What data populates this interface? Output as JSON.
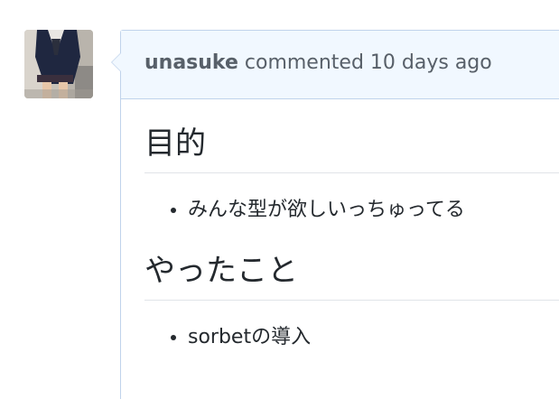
{
  "comment": {
    "author": "unasuke",
    "action": "commented",
    "time": "10 days ago"
  },
  "body": {
    "sections": [
      {
        "heading": "目的",
        "items": [
          "みんな型が欲しいっちゅってる"
        ]
      },
      {
        "heading": "やったこと",
        "items": [
          "sorbetの導入"
        ]
      }
    ]
  },
  "colors": {
    "header_bg": "#f1f8ff",
    "border": "#c0d3eb",
    "text": "#24292e",
    "muted": "#586069"
  }
}
